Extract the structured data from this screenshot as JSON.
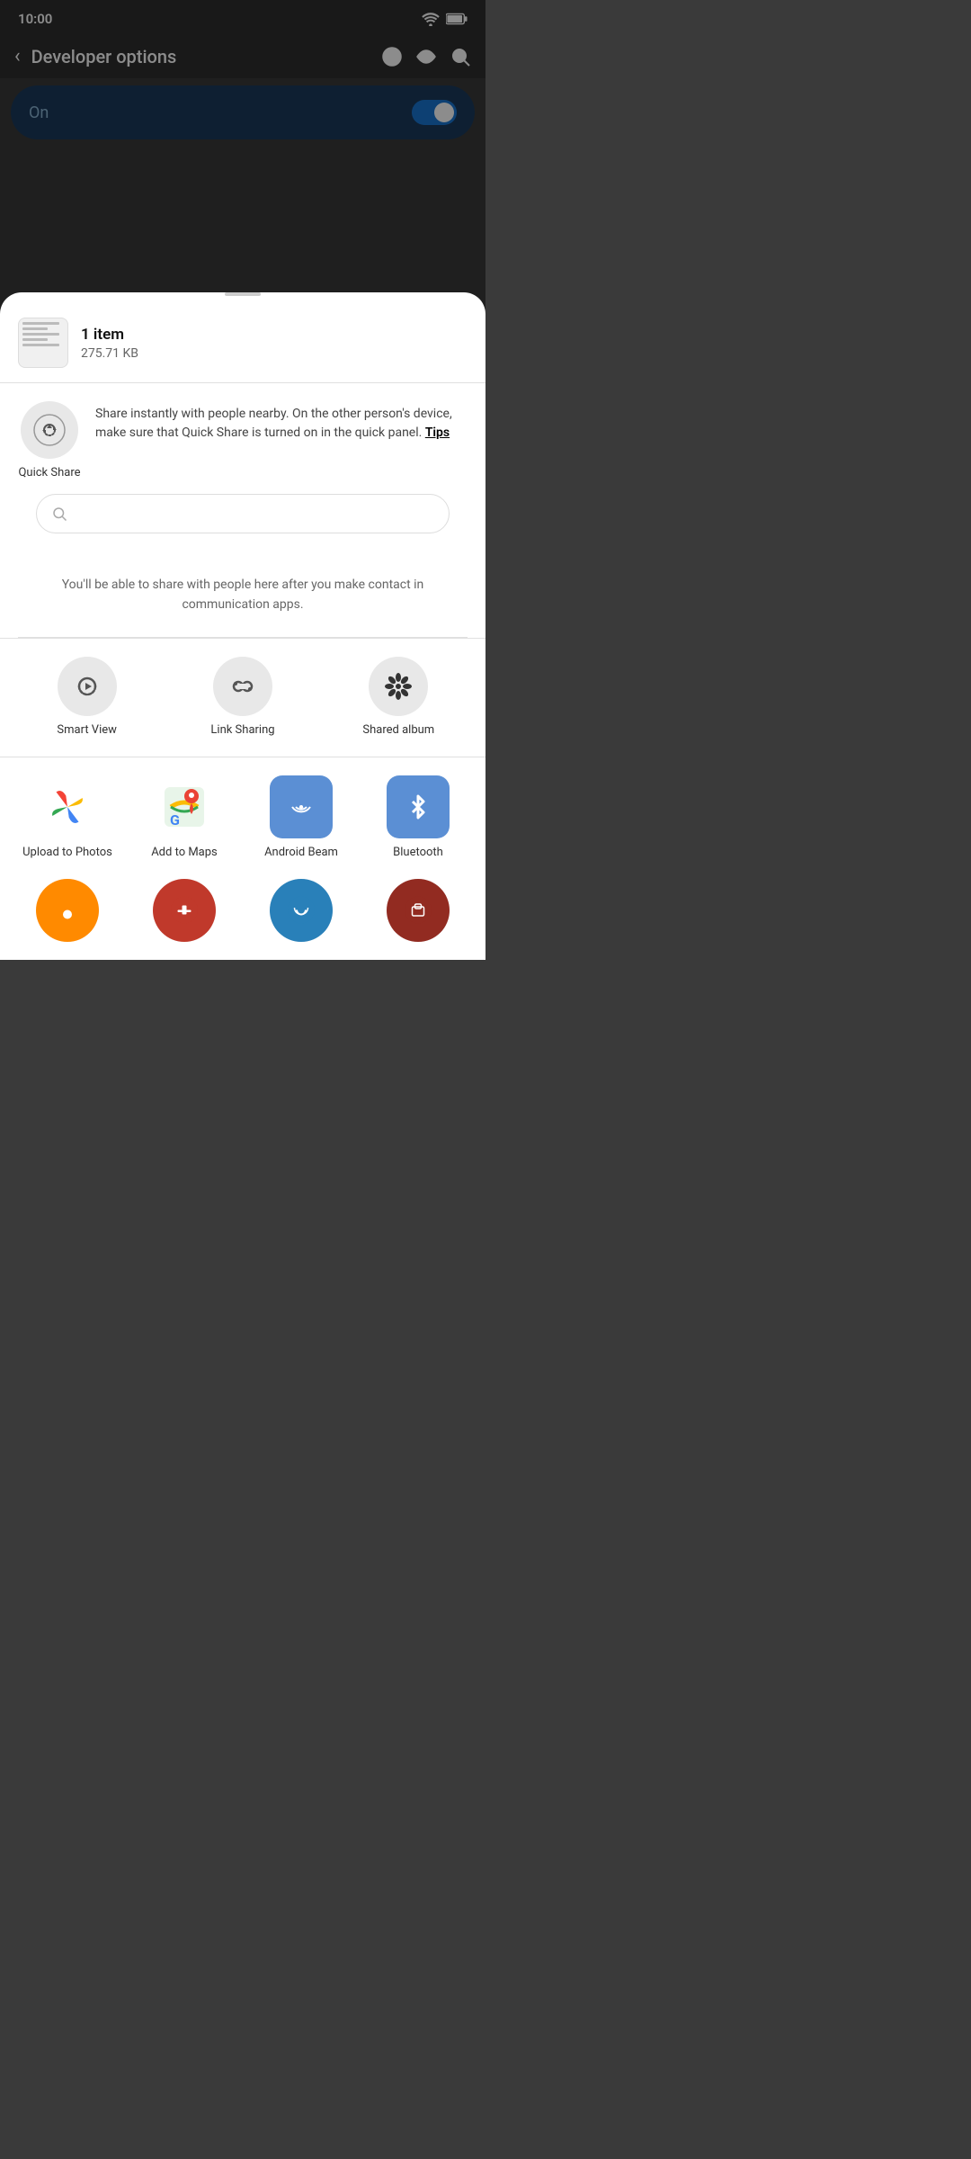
{
  "statusBar": {
    "time": "10:00"
  },
  "topBar": {
    "title": "Developer options",
    "backLabel": "‹"
  },
  "toggleBar": {
    "label": "On",
    "enabled": true
  },
  "sheet": {
    "handleLabel": "",
    "fileInfo": {
      "count": "1 item",
      "size": "275.71 KB"
    },
    "quickShare": {
      "label": "Quick Share",
      "description": "Share instantly with people nearby. On the other person's device, make sure that Quick Share is turned on in the quick panel.",
      "tipsLabel": "Tips"
    },
    "noContactsMsg": "You'll be able to share with people here after you make contact in communication apps.",
    "shareOptions": [
      {
        "id": "smart-view",
        "label": "Smart View"
      },
      {
        "id": "link-sharing",
        "label": "Link Sharing"
      },
      {
        "id": "shared-album",
        "label": "Shared album"
      }
    ],
    "apps": [
      {
        "id": "upload-photos",
        "label": "Upload to Photos"
      },
      {
        "id": "add-maps",
        "label": "Add to Maps"
      },
      {
        "id": "android-beam",
        "label": "Android Beam"
      },
      {
        "id": "bluetooth",
        "label": "Bluetooth"
      }
    ],
    "appsRowTwo": [
      {
        "id": "app-r2-1",
        "label": ""
      },
      {
        "id": "app-r2-2",
        "label": ""
      },
      {
        "id": "app-r2-3",
        "label": ""
      },
      {
        "id": "app-r2-4",
        "label": ""
      }
    ]
  },
  "colors": {
    "bluetoothBg": "#5b8fd4",
    "androidBeamBg": "#5b8fd4",
    "mapsGreen": "#0f9d58",
    "accent": "#1976d2"
  }
}
